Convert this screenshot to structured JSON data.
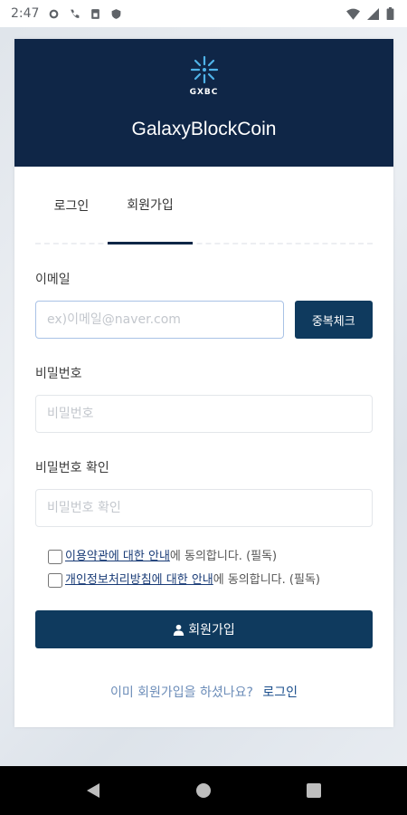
{
  "status_bar": {
    "time": "2:47"
  },
  "header": {
    "logo_text": "GXBC",
    "brand_name": "GalaxyBlockCoin"
  },
  "tabs": [
    {
      "label": "로그인",
      "active": false
    },
    {
      "label": "회원가입",
      "active": true
    }
  ],
  "form": {
    "email_label": "이메일",
    "email_placeholder": "ex)이메일@naver.com",
    "dup_check_label": "중복체크",
    "password_label": "비밀번호",
    "password_placeholder": "비밀번호",
    "password_confirm_label": "비밀번호 확인",
    "password_confirm_placeholder": "비밀번호 확인",
    "agree_terms": {
      "link": "이용약관에 대한 안내",
      "suffix": "에 동의합니다. (필독)"
    },
    "agree_privacy": {
      "link": "개인정보처리방침에 대한 안내",
      "suffix": "에 동의합니다. (필독)"
    },
    "submit_label": "회원가입"
  },
  "footer": {
    "question": "이미 회원가입을 하셨나요?",
    "login_link": "로그인"
  },
  "colors": {
    "header_bg": "#0f2647",
    "button_bg": "#0f3a5e",
    "link": "#1a4e8c"
  }
}
